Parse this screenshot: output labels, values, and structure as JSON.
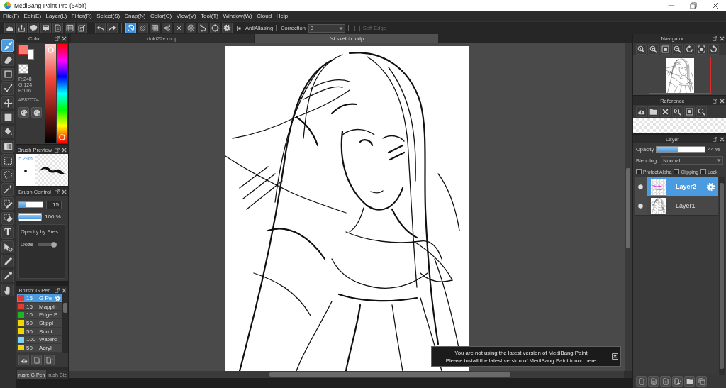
{
  "window": {
    "title": "MediBang Paint Pro (64bit)"
  },
  "menu": [
    "File(F)",
    "Edit(E)",
    "Layer(L)",
    "Filter(R)",
    "Select(S)",
    "Snap(N)",
    "Color(C)",
    "View(V)",
    "Tool(T)",
    "Window(W)",
    "Cloud",
    "Help"
  ],
  "toolbar": {
    "snaps": [
      {
        "kind": "off",
        "selected": true
      },
      {
        "kind": "parallel",
        "selected": false
      },
      {
        "kind": "grid",
        "selected": false
      },
      {
        "kind": "perspective",
        "selected": false
      },
      {
        "kind": "radial",
        "selected": false
      },
      {
        "kind": "concentric",
        "selected": false
      },
      {
        "kind": "curve",
        "selected": false
      },
      {
        "kind": "circle",
        "selected": false
      },
      {
        "kind": "settings",
        "selected": false
      }
    ],
    "antialiasing": {
      "label": "AntiAliasing",
      "checked": true
    },
    "correction": {
      "label": "Correction",
      "value": "0"
    },
    "soft_edge": {
      "label": "Soft Edge",
      "checked": false,
      "disabled": true
    }
  },
  "tools": [
    {
      "kind": "brush",
      "selected": true
    },
    {
      "kind": "eraser",
      "selected": false
    },
    {
      "kind": "square",
      "selected": false
    },
    {
      "kind": "polyline",
      "selected": false
    },
    {
      "kind": "move",
      "selected": false
    },
    {
      "kind": "fill",
      "selected": false
    },
    {
      "kind": "bucket",
      "selected": false
    },
    {
      "kind": "gradient",
      "selected": false
    },
    {
      "kind": "select",
      "selected": false
    },
    {
      "kind": "lasso",
      "selected": false
    },
    {
      "kind": "wand",
      "selected": false
    },
    {
      "kind": "select_pen",
      "selected": false
    },
    {
      "kind": "select_eraser",
      "selected": false
    },
    {
      "kind": "text",
      "label": "T",
      "selected": false
    },
    {
      "kind": "pointer",
      "selected": false
    },
    {
      "kind": "pen",
      "selected": false
    },
    {
      "kind": "eyedropper",
      "selected": false
    },
    {
      "kind": "hand",
      "selected": false
    }
  ],
  "color_panel": {
    "title": "Color",
    "channels": [
      "R:248",
      "G:124",
      "B:116"
    ],
    "hex": "#F87C74",
    "lightness": {
      "level": 0.97
    },
    "hue": {
      "level": 0.02
    }
  },
  "brush_preview": {
    "title": "Brush Preview",
    "size": "5.29m"
  },
  "brush_control": {
    "title": "Brush Control",
    "size": {
      "level": 0.28,
      "value": "15"
    },
    "opacity": {
      "level": 1,
      "value": "100 %"
    },
    "pressure_label": "Opacity by Pres",
    "ooze": {
      "label": "Ooze",
      "level": 0.95
    }
  },
  "brush_list": {
    "title": "Brush: G Pen",
    "items": [
      {
        "size": "15",
        "name": "G Pe",
        "color": "#e53935",
        "selected": true
      },
      {
        "size": "15",
        "name": "Mappin",
        "color": "#e53935",
        "selected": false
      },
      {
        "size": "10",
        "name": "Edge P",
        "color": "#1fb51f",
        "selected": false
      },
      {
        "size": "50",
        "name": "Stippl",
        "color": "#f2d600",
        "selected": false
      },
      {
        "size": "50",
        "name": "Sumi",
        "color": "#f2d600",
        "selected": false
      },
      {
        "size": "100",
        "name": "Waterc",
        "color": "#7fd3f5",
        "selected": false
      },
      {
        "size": "50",
        "name": "Acryli",
        "color": "#f2d600",
        "selected": false
      }
    ],
    "tabs": [
      {
        "label": "rush: G Pen",
        "selected": true
      },
      {
        "label": "rush Siz",
        "selected": false
      }
    ]
  },
  "document_tabs": [
    {
      "label": "doki22e.mdp",
      "selected": false
    },
    {
      "label": "fst.sketch.mdp",
      "selected": true
    }
  ],
  "notification": {
    "lines": [
      "You are not using the latest version of MediBang Paint.",
      "Please install the latest version of MediBang Paint found here."
    ]
  },
  "navigator": {
    "title": "Navigator"
  },
  "reference": {
    "title": "Reference"
  },
  "layer_panel": {
    "title": "Layer",
    "opacity": {
      "label": "Opacity",
      "level": 0.44,
      "value": "44 %"
    },
    "blending": {
      "label": "Blending",
      "value": "Normal"
    },
    "options": [
      {
        "label": "Protect Alpha",
        "checked": false
      },
      {
        "label": "Clipping",
        "checked": false
      },
      {
        "label": "Lock",
        "checked": false
      }
    ],
    "layers": [
      {
        "name": "Layer2",
        "selected": true,
        "visible": true
      },
      {
        "name": "Layer1",
        "selected": false,
        "visible": true
      }
    ]
  }
}
